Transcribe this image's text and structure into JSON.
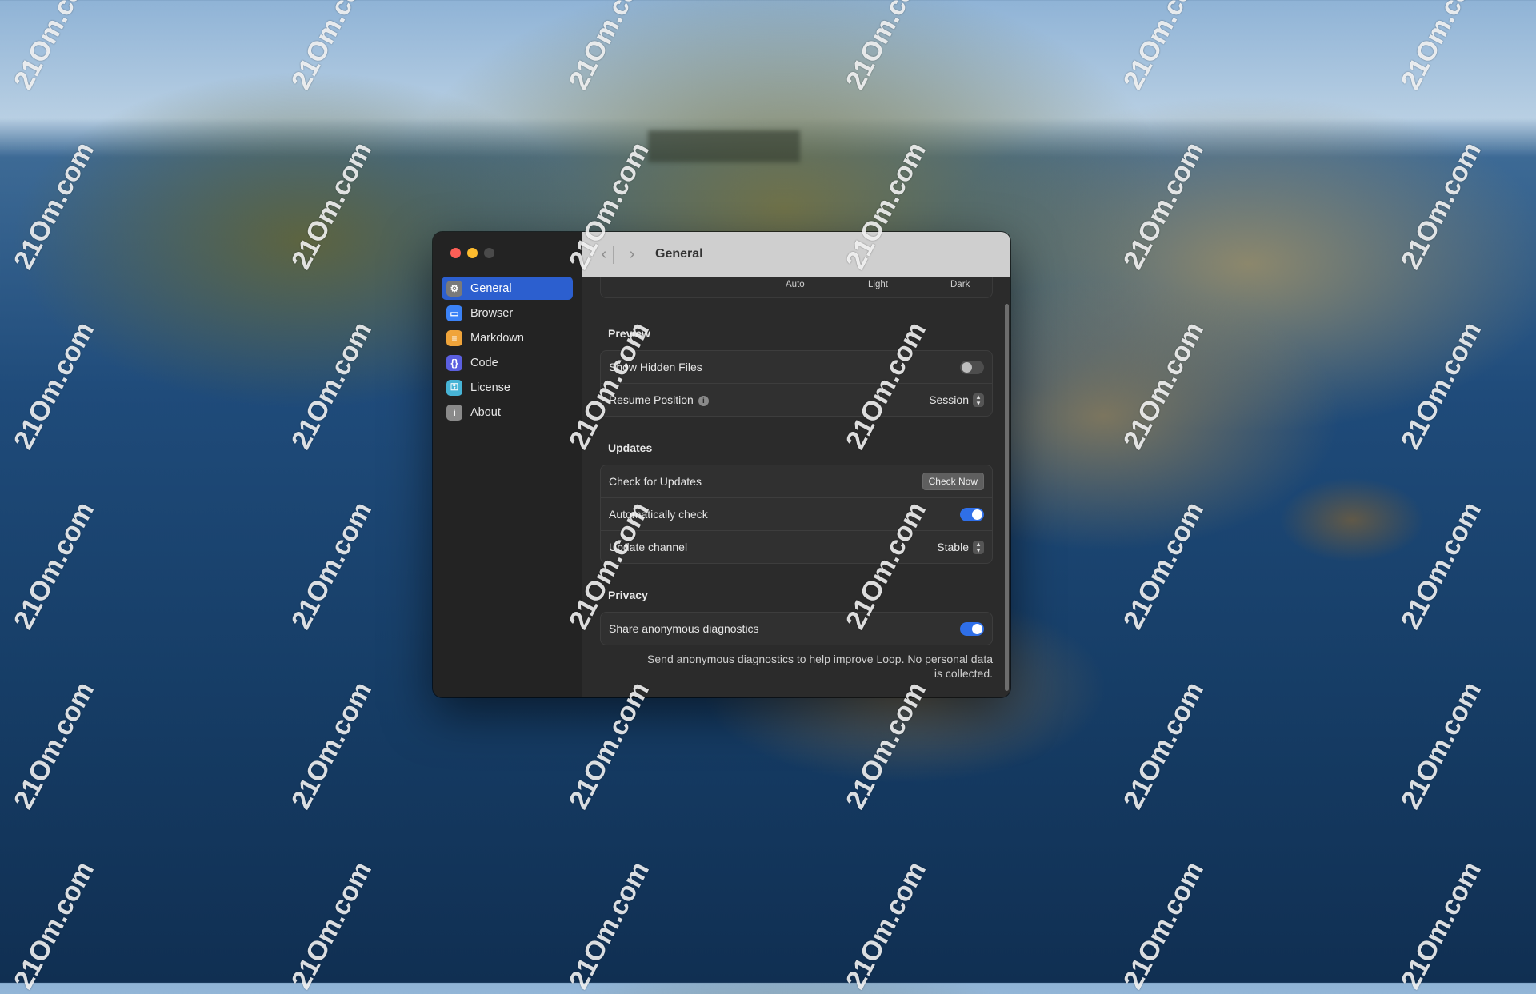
{
  "watermark": "21Om.com",
  "window": {
    "title": "General",
    "sidebar": {
      "items": [
        {
          "label": "General",
          "icon": "gear-icon",
          "color": "#7a7a7a",
          "glyph": "⚙",
          "active": true
        },
        {
          "label": "Browser",
          "icon": "browser-window-icon",
          "color": "#3b82f6",
          "glyph": "▭",
          "active": false
        },
        {
          "label": "Markdown",
          "icon": "document-icon",
          "color": "#f0a43a",
          "glyph": "≡",
          "active": false
        },
        {
          "label": "Code",
          "icon": "braces-icon",
          "color": "#5b5fe0",
          "glyph": "{}",
          "active": false
        },
        {
          "label": "License",
          "icon": "key-icon",
          "color": "#47b4d6",
          "glyph": "⚿",
          "active": false
        },
        {
          "label": "About",
          "icon": "info-icon",
          "color": "#8a8a8a",
          "glyph": "i",
          "active": false
        }
      ]
    },
    "appearance_options": [
      "Auto",
      "Light",
      "Dark"
    ],
    "sections": {
      "preview": {
        "title": "Preview",
        "show_hidden_files": {
          "label": "Show Hidden Files",
          "on": false
        },
        "resume_position": {
          "label": "Resume Position",
          "value": "Session"
        }
      },
      "updates": {
        "title": "Updates",
        "check_for_updates": {
          "label": "Check for Updates",
          "button": "Check Now"
        },
        "automatically_check": {
          "label": "Automatically check",
          "on": true
        },
        "update_channel": {
          "label": "Update channel",
          "value": "Stable"
        }
      },
      "privacy": {
        "title": "Privacy",
        "share_diagnostics": {
          "label": "Share anonymous diagnostics",
          "on": true
        },
        "footnote_line1": "Send anonymous diagnostics to help improve Loop. No personal data",
        "footnote_line2": "is collected."
      }
    }
  }
}
